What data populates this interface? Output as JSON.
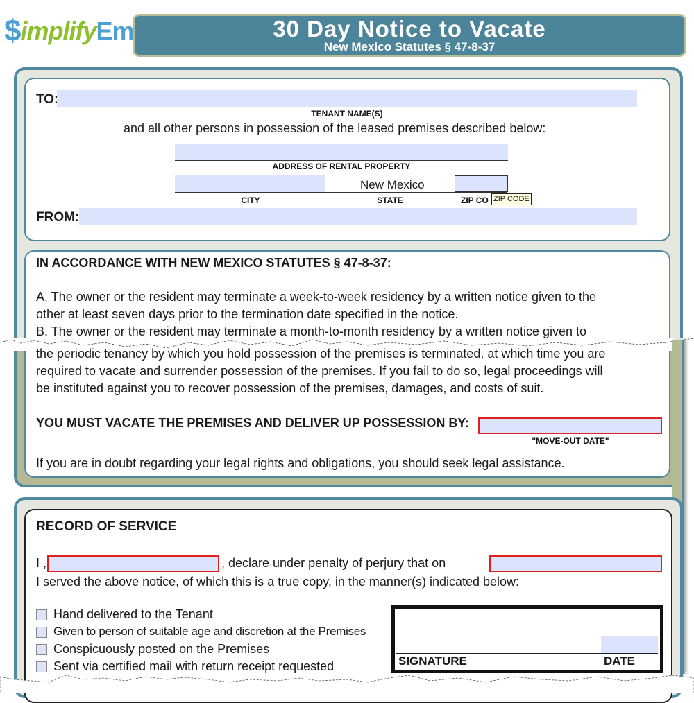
{
  "logo": {
    "dollar": "$",
    "mid": "implify",
    "end": "Em"
  },
  "header": {
    "title": "30 Day Notice to Vacate",
    "subtitle": "New Mexico Statutes § 47-8-37"
  },
  "parties": {
    "to_label": "TO:",
    "tenant_label": "TENANT NAME(S)",
    "others_text": "and all other persons in possession of the leased premises described below:",
    "address_label": "ADDRESS OF RENTAL PROPERTY",
    "city_label": "CITY",
    "state_value": "New Mexico",
    "state_label": "STATE",
    "zip_label": "ZIP CO",
    "zip_tooltip": "ZIP CODE",
    "from_label": "FROM:",
    "fields": {
      "tenant_name": "",
      "address": "",
      "city": "",
      "zip": "",
      "from": ""
    }
  },
  "statute": {
    "heading": "IN ACCORDANCE WITH NEW MEXICO STATUTES § 47-8-37:",
    "lines": [
      "A. The owner or the resident may terminate a week-to-week residency by a written notice given to the",
      "other at least seven days prior to the termination date specified in the notice.",
      "B. The owner or the resident may terminate a month-to-month residency by a written notice given to",
      "the periodic tenancy by which you hold possession of the premises is terminated, at which time you are",
      "required to vacate and surrender possession of the premises. If you fail to do so, legal proceedings will",
      "be instituted against you to recover possession of the premises, damages, and costs of suit."
    ],
    "vacate_label": "YOU MUST VACATE THE PREMISES AND DELIVER UP POSSESSION BY:",
    "move_out_label": "\"MOVE-OUT DATE\"",
    "move_out_value": "",
    "doubt_text": "If you are in doubt regarding your legal rights and obligations, you should seek legal assistance."
  },
  "service": {
    "heading": "RECORD OF SERVICE",
    "i_prefix": "I ,",
    "declare_text": ", declare under penalty of perjury that on",
    "served_text": "I served the above notice, of which this is a true copy, in the manner(s) indicated below:",
    "server_name": "",
    "service_date": "",
    "methods": [
      {
        "label": "Hand delivered to the Tenant",
        "checked": false
      },
      {
        "label": "Given to person of suitable age and discretion at the Premises",
        "checked": false
      },
      {
        "label": "Conspicuously posted on the Premises",
        "checked": false
      },
      {
        "label": "Sent via certified mail with return receipt requested",
        "checked": false
      }
    ],
    "signature_label": "SIGNATURE",
    "date_label": "DATE",
    "signature_date": ""
  }
}
